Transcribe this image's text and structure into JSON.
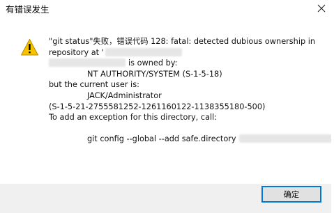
{
  "window": {
    "title": "有错误发生",
    "close_icon": "close-icon"
  },
  "message": {
    "icon": "warning-icon",
    "line1": "\"git status\"失败，错误代码 128: fatal: detected dubious ownership in",
    "line2": "repository at '",
    "line3": "is owned by:",
    "line4": "NT AUTHORITY/SYSTEM (S-1-5-18)",
    "line5": "but the current user is:",
    "line6": "JACK/Administrator",
    "line7": "(S-1-5-21-2755581252-1261160122-1138355180-500)",
    "line8": "To add an exception for this directory, call:",
    "line9": "git config --global --add safe.directory"
  },
  "buttons": {
    "ok_label": "确定"
  }
}
